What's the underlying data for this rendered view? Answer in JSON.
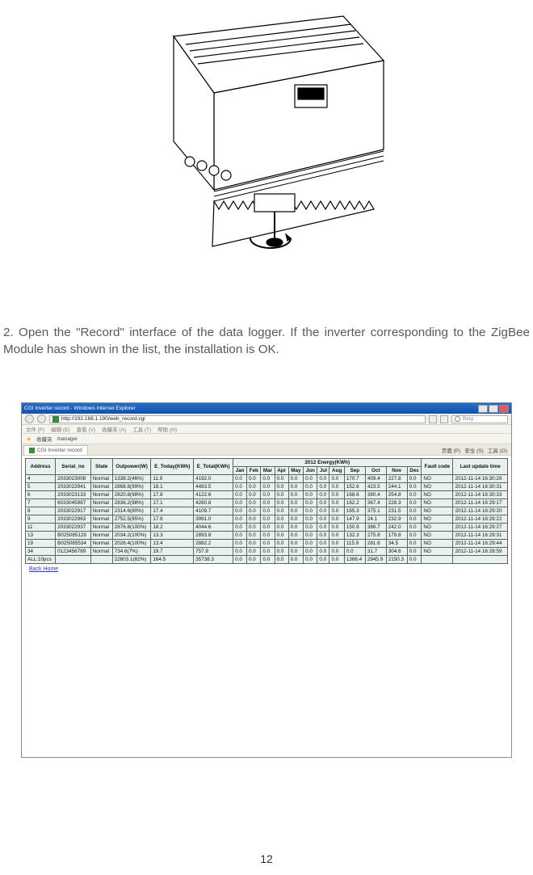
{
  "instruction": "2. Open the \"Record\" interface of the data logger. If the inverter corresponding to the ZigBee Module has shown in the list, the installation is OK.",
  "page_number": "12",
  "browser": {
    "title": "CGI Inverter record - Windows Internet Explorer",
    "url": "http://192.168.1.190/web_record.cgi",
    "search_placeholder": "Bing",
    "menus": [
      "文件 (F)",
      "编辑 (E)",
      "查看 (V)",
      "收藏夹 (A)",
      "工具 (T)",
      "帮助 (H)"
    ],
    "fav_label": "收藏夹",
    "fav_item": "manager",
    "tab_label": "CGI Inverter record",
    "right_tools": [
      "页面 (P)",
      "安全 (S)",
      "工具 (O)"
    ]
  },
  "table": {
    "year_header": "2012 Energy(KWh)",
    "headers_left": [
      "Address",
      "Serial_no",
      "State",
      "Outpower(W)",
      "E_Today(KWh)",
      "E_Total(KWh)"
    ],
    "headers_months": [
      "Jan",
      "Feb",
      "Mar",
      "Apr",
      "May",
      "Jun",
      "Jul",
      "Aug",
      "Sep",
      "Oct",
      "Nov",
      "Dec"
    ],
    "headers_right": [
      "Fault code",
      "Last update time"
    ],
    "rows": [
      {
        "addr": "4",
        "sn": "2033023008",
        "st": "Normal",
        "out": "1338.2(46%)",
        "etoday": "11.9",
        "etotal": "4192.0",
        "m": [
          "0.0",
          "0.0",
          "0.0",
          "0.0",
          "0.0",
          "0.0",
          "0.0",
          "0.0",
          "170.7",
          "409.4",
          "227.8",
          "0.0"
        ],
        "fc": "NO",
        "lu": "2012-11-14 16:30:29"
      },
      {
        "addr": "5",
        "sn": "2033022941",
        "st": "Normal",
        "out": "2868.8(99%)",
        "etoday": "18.1",
        "etotal": "4483.5",
        "m": [
          "0.0",
          "0.0",
          "0.0",
          "0.0",
          "0.0",
          "0.0",
          "0.0",
          "0.0",
          "152.6",
          "423.5",
          "244.1",
          "0.0"
        ],
        "fc": "NO",
        "lu": "2012-11-14 16:30:31"
      },
      {
        "addr": "6",
        "sn": "2033023133",
        "st": "Normal",
        "out": "2820.8(98%)",
        "etoday": "17.8",
        "etotal": "4122.6",
        "m": [
          "0.0",
          "0.0",
          "0.0",
          "0.0",
          "0.0",
          "0.0",
          "0.0",
          "0.0",
          "168.6",
          "380.4",
          "254.8",
          "0.0"
        ],
        "fc": "NO",
        "lu": "2012-11-14 16:30:33"
      },
      {
        "addr": "7",
        "sn": "6033045987",
        "st": "Normal",
        "out": "2836.2(98%)",
        "etoday": "17.1",
        "etotal": "4260.8",
        "m": [
          "0.0",
          "0.0",
          "0.0",
          "0.0",
          "0.0",
          "0.0",
          "0.0",
          "0.0",
          "162.2",
          "367.4",
          "228.3",
          "0.0"
        ],
        "fc": "NO",
        "lu": "2012-11-14 16:29:17"
      },
      {
        "addr": "8",
        "sn": "2033022917",
        "st": "Normal",
        "out": "2314.6(80%)",
        "etoday": "17.4",
        "etotal": "4109.7",
        "m": [
          "0.0",
          "0.0",
          "0.0",
          "0.0",
          "0.0",
          "0.0",
          "0.0",
          "0.0",
          "165.3",
          "375.1",
          "231.5",
          "0.0"
        ],
        "fc": "NO",
        "lu": "2012-11-14 16:29:20"
      },
      {
        "addr": "9",
        "sn": "2033022963",
        "st": "Normal",
        "out": "2752.5(95%)",
        "etoday": "17.6",
        "etotal": "3991.0",
        "m": [
          "0.0",
          "0.0",
          "0.0",
          "0.0",
          "0.0",
          "0.0",
          "0.0",
          "0.0",
          "147.9",
          "24.1",
          "232.9",
          "0.0"
        ],
        "fc": "NO",
        "lu": "2012-11-14 16:29:22"
      },
      {
        "addr": "11",
        "sn": "2033022937",
        "st": "Normal",
        "out": "2876.8(100%)",
        "etoday": "18.2",
        "etotal": "4044.6",
        "m": [
          "0.0",
          "0.0",
          "0.0",
          "0.0",
          "0.0",
          "0.0",
          "0.0",
          "0.0",
          "150.9",
          "386.7",
          "242.0",
          "0.0"
        ],
        "fc": "NO",
        "lu": "2012-11-14 16:29:27"
      },
      {
        "addr": "13",
        "sn": "B025085129",
        "st": "Normal",
        "out": "2034.2(100%)",
        "etoday": "13.3",
        "etotal": "2893.8",
        "m": [
          "0.0",
          "0.0",
          "0.0",
          "0.0",
          "0.0",
          "0.0",
          "0.0",
          "0.0",
          "132.3",
          "275.8",
          "179.8",
          "0.0"
        ],
        "fc": "NO",
        "lu": "2012-11-14 16:29:31"
      },
      {
        "addr": "19",
        "sn": "B025085534",
        "st": "Normal",
        "out": "2026.4(100%)",
        "etoday": "13.4",
        "etotal": "2882.2",
        "m": [
          "0.0",
          "0.0",
          "0.0",
          "0.0",
          "0.0",
          "0.0",
          "0.0",
          "0.0",
          "115.9",
          "281.8",
          "34.5",
          "0.0"
        ],
        "fc": "NO",
        "lu": "2012-11-14 16:29:44"
      },
      {
        "addr": "34",
        "sn": "0123456789",
        "st": "Normal",
        "out": "734.6(7%)",
        "etoday": "19.7",
        "etotal": "757.9",
        "m": [
          "0.0",
          "0.0",
          "0.0",
          "0.0",
          "0.0",
          "0.0",
          "0.0",
          "0.0",
          "0.0",
          "31.7",
          "304.6",
          "0.0"
        ],
        "fc": "NO",
        "lu": "2012-11-14 16:28:59"
      }
    ],
    "summary": {
      "label": "ALL:10pcs",
      "out": "22603.1(82%)",
      "etoday": "164.5",
      "etotal": "35738.3",
      "m": [
        "0.0",
        "0.0",
        "0.0",
        "0.0",
        "0.0",
        "0.0",
        "0.0",
        "0.0",
        "1366.4",
        "2945.9",
        "2150.3",
        "0.0"
      ]
    },
    "back_home": "Back Home"
  }
}
